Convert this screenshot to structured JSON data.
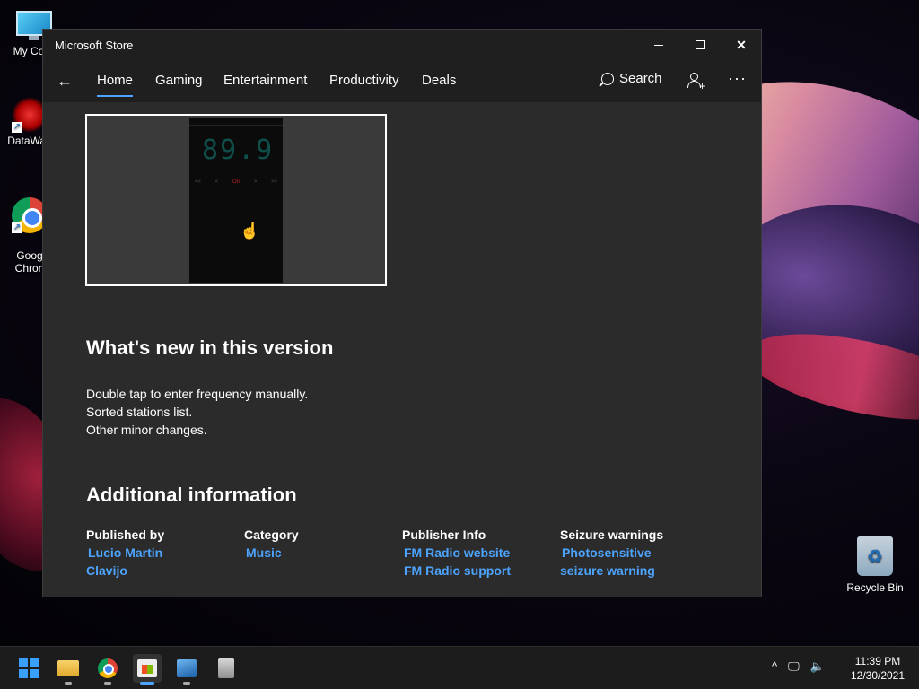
{
  "desktop": {
    "icons": [
      {
        "label": "My Com"
      },
      {
        "label": "DataWag"
      },
      {
        "label": "Goog\nChron"
      },
      {
        "label": "Recycle Bin"
      }
    ]
  },
  "window": {
    "title": "Microsoft Store",
    "controls": {
      "minimize": "minimize",
      "maximize": "maximize",
      "close": "✕"
    }
  },
  "nav": {
    "back": "←",
    "tabs": [
      "Home",
      "Gaming",
      "Entertainment",
      "Productivity",
      "Deals"
    ],
    "active_tab": "Home",
    "search_label": "Search",
    "more": "···"
  },
  "screenshot": {
    "frequency": "89.9",
    "controls": [
      "<<",
      "<",
      "On",
      ">",
      ">>"
    ]
  },
  "whats_new": {
    "title": "What's new in this version",
    "notes": [
      "Double tap to enter frequency manually.",
      "Sorted stations list.",
      "Other minor changes."
    ]
  },
  "additional_info": {
    "title": "Additional information",
    "columns": [
      {
        "heading": "Published by",
        "links": [
          "Lucio Martin",
          "Clavijo"
        ]
      },
      {
        "heading": "Category",
        "links": [
          "Music"
        ]
      },
      {
        "heading": "Publisher Info",
        "links": [
          "FM Radio website",
          "FM Radio support"
        ]
      },
      {
        "heading": "Seizure warnings",
        "links": [
          "Photosensitive",
          "seizure warning"
        ]
      }
    ]
  },
  "taskbar": {
    "apps": [
      "start",
      "file-explorer",
      "chrome",
      "microsoft-store",
      "photos",
      "app"
    ],
    "active_app": "microsoft-store",
    "tray": {
      "chevron": "^",
      "network": "🖵",
      "volume": "🔈"
    },
    "clock": {
      "time": "11:39 PM",
      "date": "12/30/2021"
    }
  },
  "colors": {
    "accent": "#4ca4ff",
    "window_bg": "#2b2b2b",
    "titlebar_bg": "#1f1f1f"
  }
}
